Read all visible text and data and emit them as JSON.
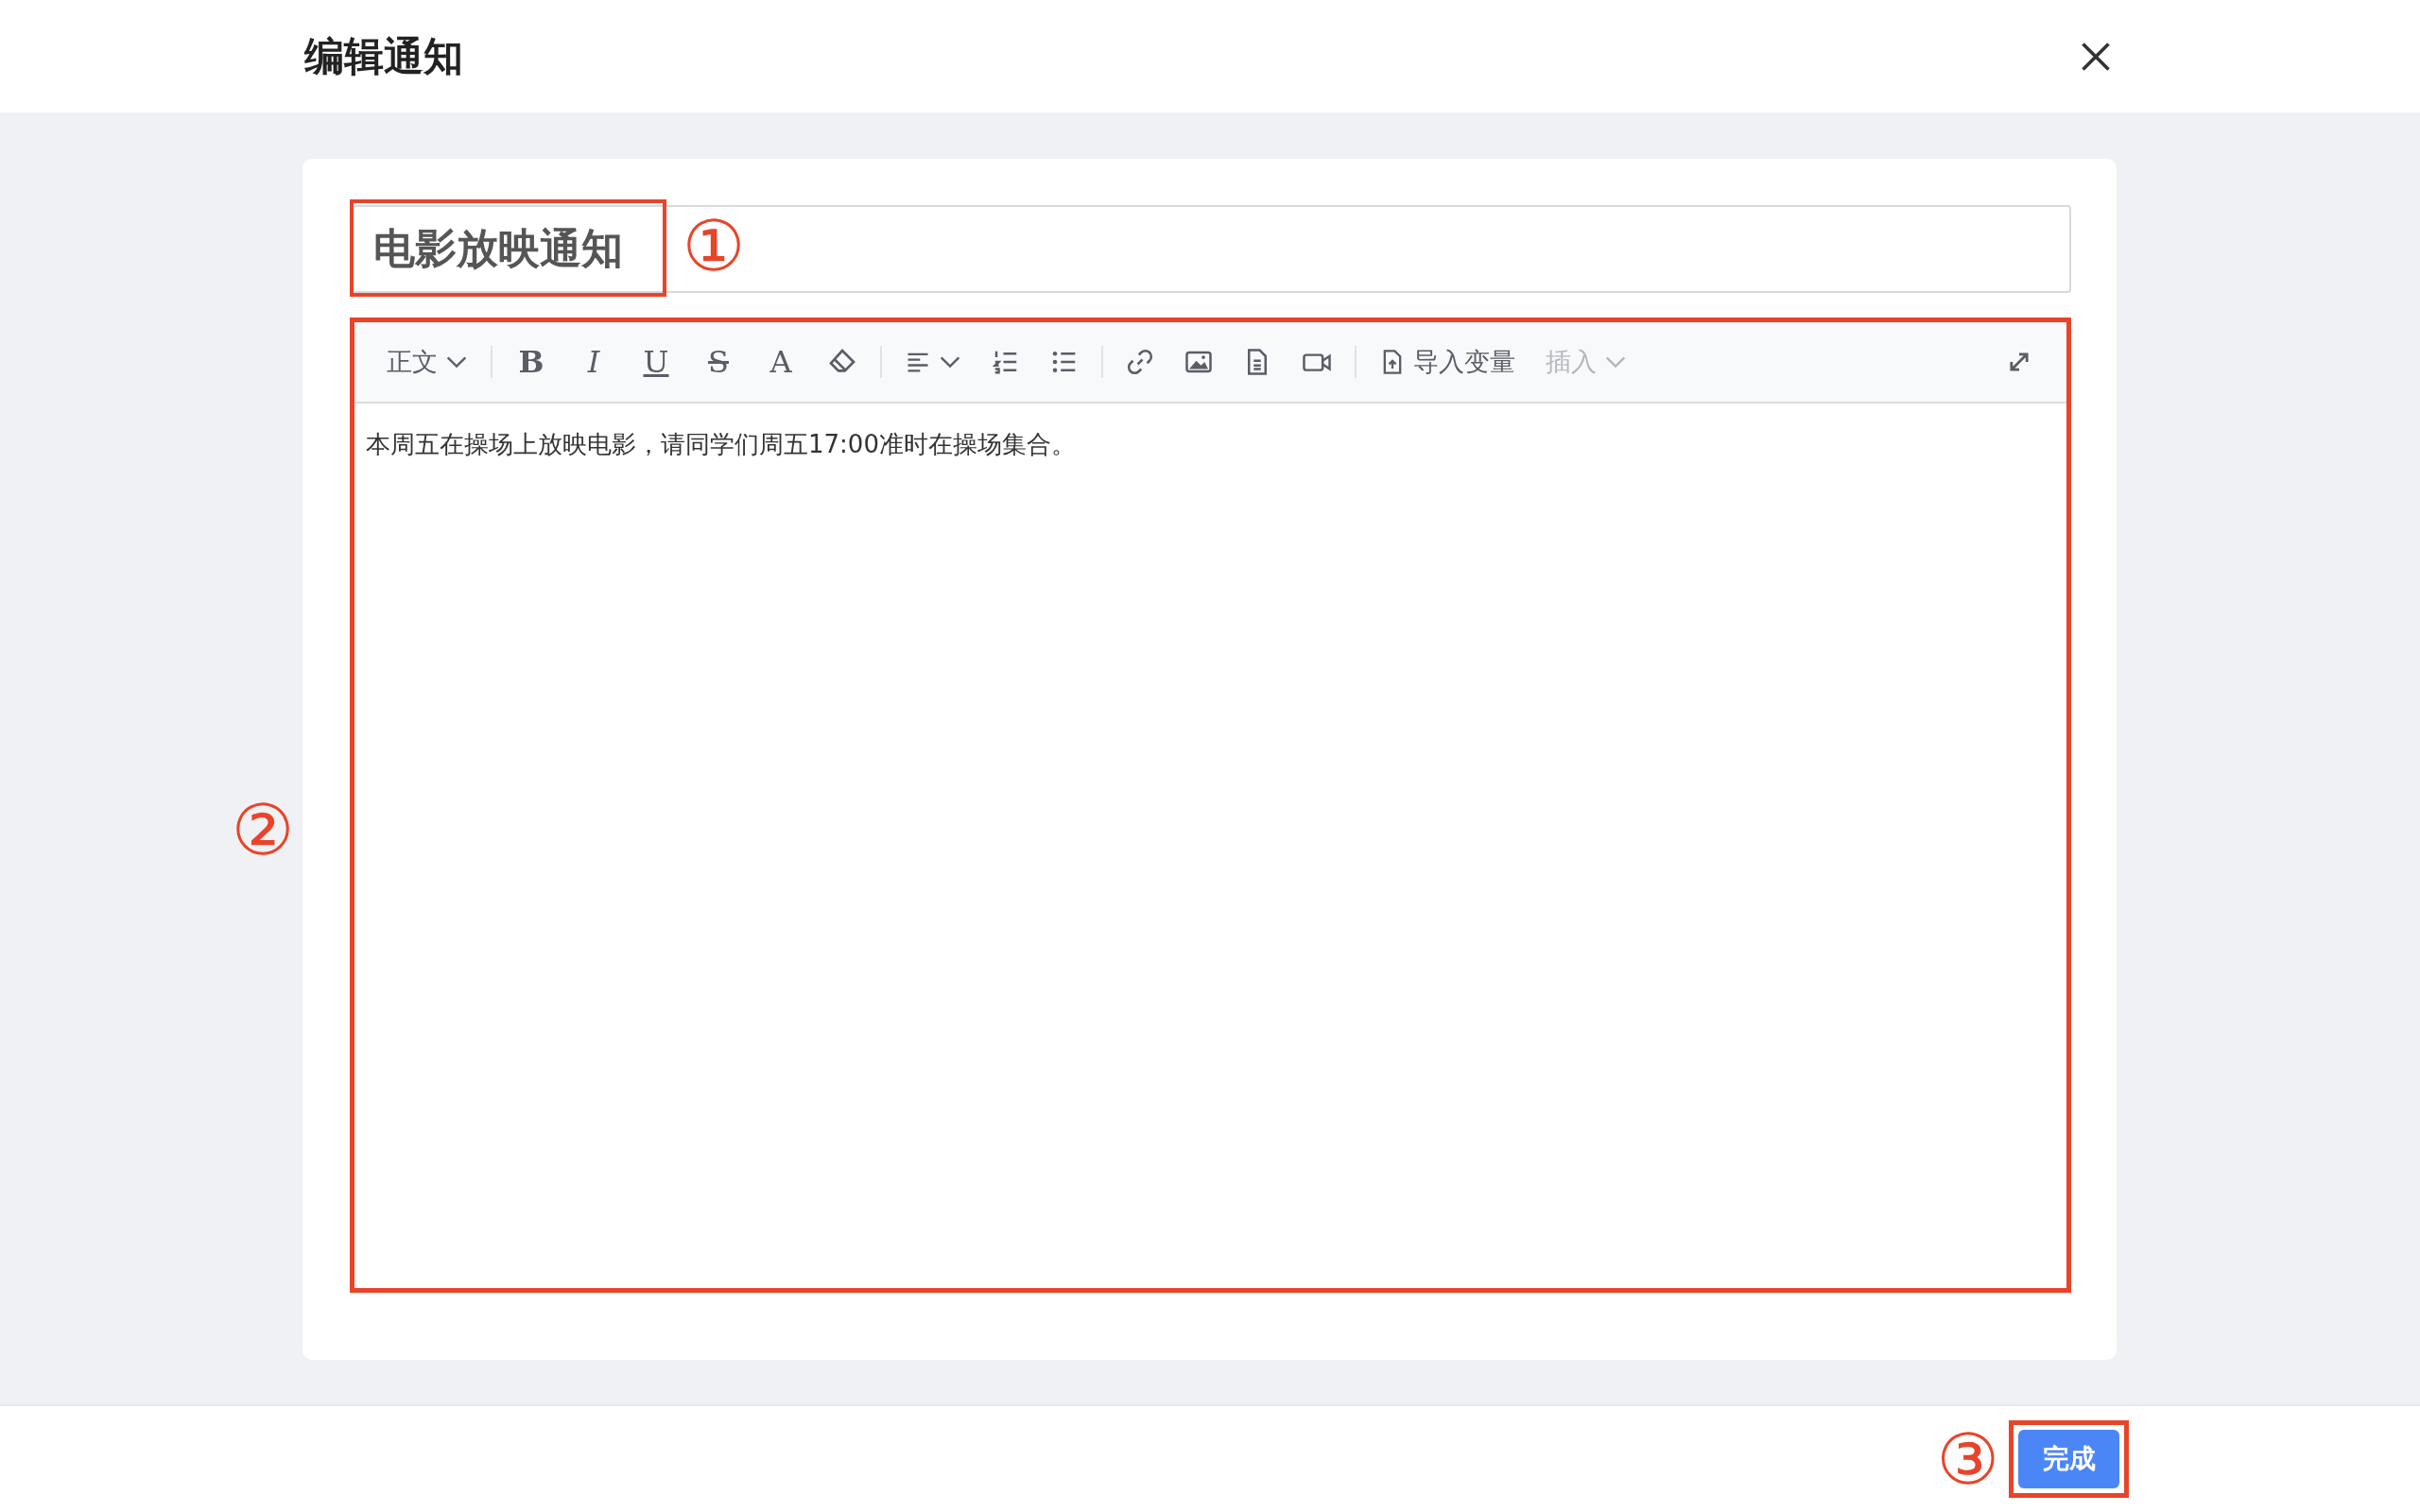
{
  "dialog": {
    "title": "编辑通知"
  },
  "subject": {
    "value": "电影放映通知"
  },
  "toolbar": [
    {
      "kind": "dropdown",
      "label": "正文",
      "disabled": false
    },
    {
      "kind": "separator"
    },
    {
      "kind": "bold",
      "text": "B"
    },
    {
      "kind": "italic",
      "text": "I"
    },
    {
      "kind": "underline",
      "text": "U"
    },
    {
      "kind": "strike",
      "text": "S"
    },
    {
      "kind": "color",
      "text": "A"
    },
    {
      "kind": "eraser"
    },
    {
      "kind": "separator"
    },
    {
      "kind": "align"
    },
    {
      "kind": "ordered"
    },
    {
      "kind": "bullets"
    },
    {
      "kind": "separator"
    },
    {
      "kind": "link"
    },
    {
      "kind": "image"
    },
    {
      "kind": "file"
    },
    {
      "kind": "video"
    },
    {
      "kind": "separator"
    },
    {
      "kind": "upload",
      "label": "导入变量"
    },
    {
      "kind": "dropdown",
      "label": "插入",
      "disabled": true
    }
  ],
  "body": {
    "text": "本周五在操场上放映电影，请同学们周五17:00准时在操场集合。"
  },
  "footer": {
    "button": "完成"
  },
  "annotations": [
    "①",
    "②",
    "③"
  ]
}
